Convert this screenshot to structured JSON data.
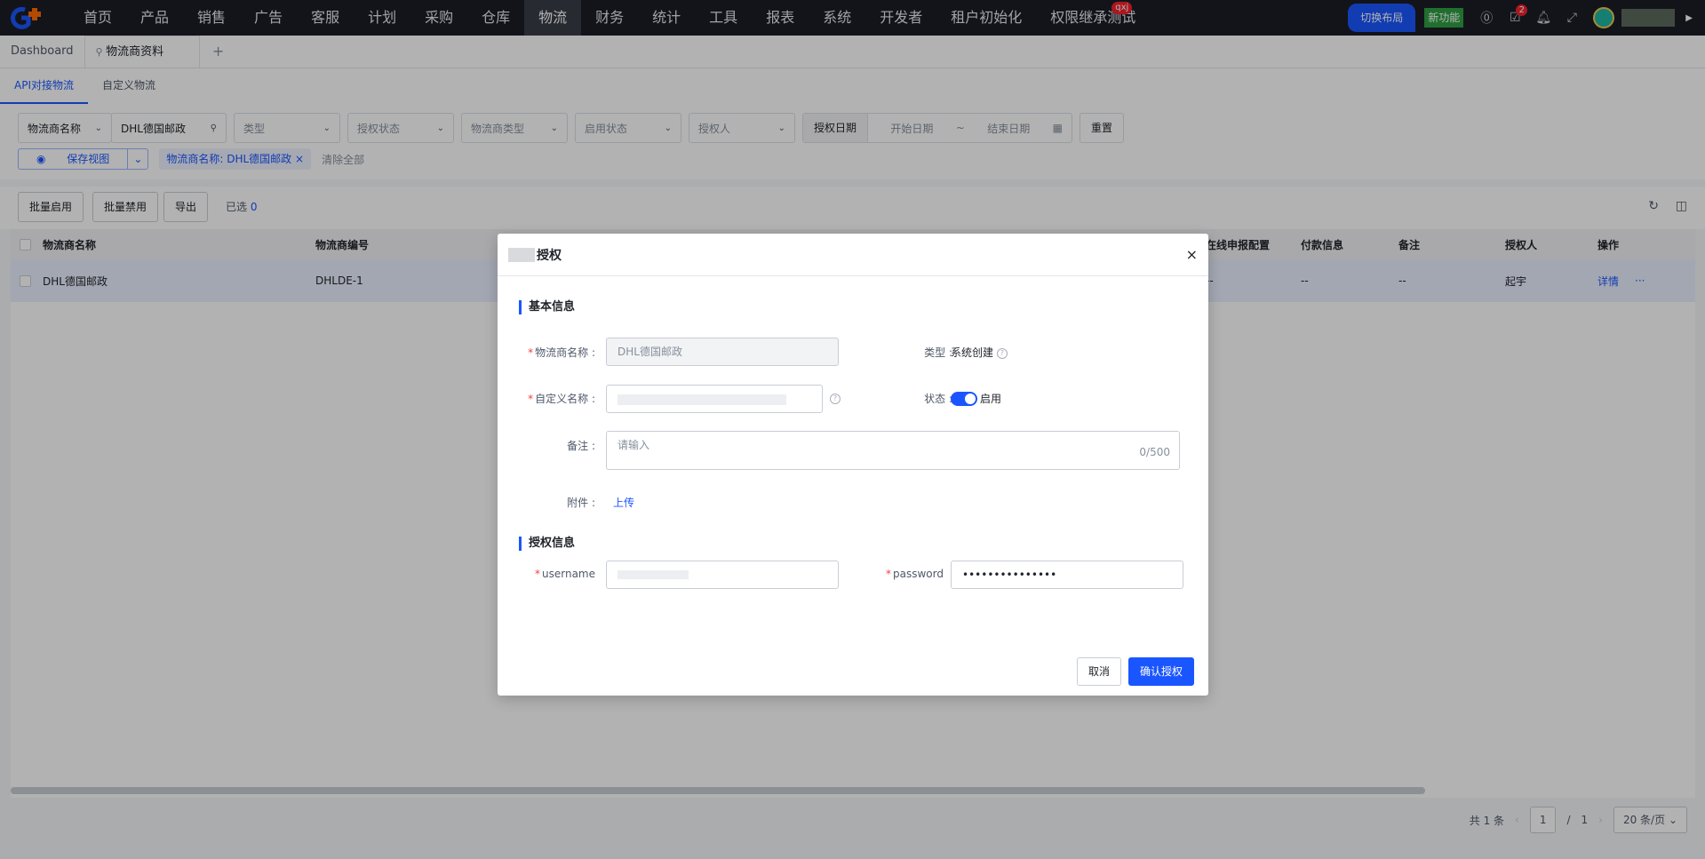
{
  "nav": {
    "items": [
      "首页",
      "产品",
      "销售",
      "广告",
      "客服",
      "计划",
      "采购",
      "仓库",
      "物流",
      "财务",
      "统计",
      "工具",
      "报表",
      "系统",
      "开发者",
      "租户初始化",
      "权限继承测试"
    ],
    "active_index": 8,
    "badge_text": "qxj",
    "switch_layout": "切换布局",
    "new_feature": "新功能",
    "task_badge": "2"
  },
  "page_tabs": {
    "home": "Dashboard",
    "current": "物流商资料",
    "add": "+"
  },
  "sub_tabs": [
    "API对接物流",
    "自定义物流"
  ],
  "filters": {
    "field_select": "物流商名称",
    "field_value": "DHL德国邮政",
    "type": "类型",
    "auth_status": "授权状态",
    "carrier_type": "物流商类型",
    "enable_status": "启用状态",
    "authorizer": "授权人",
    "auth_date": "授权日期",
    "start_date": "开始日期",
    "date_sep": "~",
    "end_date": "结束日期",
    "reset": "重置",
    "save_view": "保存视图",
    "chip": "物流商名称: DHL德国邮政",
    "clear_all": "清除全部"
  },
  "toolbar": {
    "batch_enable": "批量启用",
    "batch_disable": "批量禁用",
    "export": "导出",
    "selected_label": "已选",
    "selected_count": "0"
  },
  "table": {
    "headers": {
      "name": "物流商名称",
      "code": "物流商编号",
      "online_decl": "在线申报配置",
      "payment": "付款信息",
      "remark": "备注",
      "authorizer": "授权人",
      "actions": "操作"
    },
    "rows": [
      {
        "name": "DHL德国邮政",
        "code": "DHLDE-1",
        "online_decl": "--",
        "payment": "--",
        "remark": "--",
        "authorizer": "起宇",
        "detail": "详情",
        "more": "···"
      }
    ]
  },
  "pager": {
    "total": "共 1 条",
    "page": "1",
    "sep": "/",
    "pages": "1",
    "page_size": "20 条/页"
  },
  "modal": {
    "title": "授权",
    "close": "×",
    "section_basic": "基本信息",
    "name_label": "物流商名称 :",
    "name_value": "DHL德国邮政",
    "type_label": "类型 :",
    "type_value": "系统创建",
    "custom_label": "自定义名称 :",
    "status_label": "状态 :",
    "status_value": "启用",
    "remark_label": "备注 :",
    "remark_placeholder": "请输入",
    "remark_count": "0/500",
    "attach_label": "附件 :",
    "upload": "上传",
    "section_auth": "授权信息",
    "username_label": "username",
    "password_label": "password",
    "password_value": "•••••••••••••••",
    "cancel": "取消",
    "confirm": "确认授权"
  }
}
